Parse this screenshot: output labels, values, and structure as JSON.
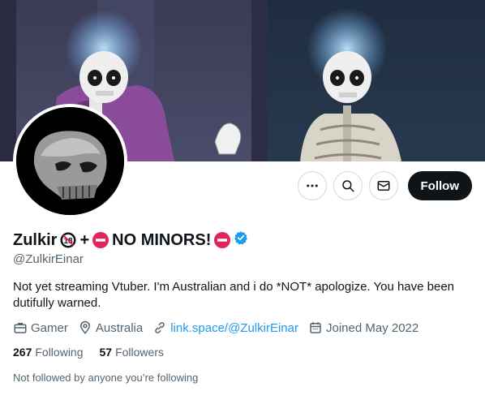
{
  "profile": {
    "name": "Zulkir",
    "name_suffix_plus": "+",
    "name_tag": "NO MINORS!",
    "handle": "@ZulkirEinar",
    "bio": "Not yet streaming Vtuber. I'm Australian and i do *NOT* apologize. You have been dutifully warned.",
    "verified": true
  },
  "meta": {
    "category": "Gamer",
    "location": "Australia",
    "link": "link.space/@ZulkirEinar",
    "joined": "Joined May 2022"
  },
  "stats": {
    "following_count": "267",
    "following_label": "Following",
    "followers_count": "57",
    "followers_label": "Followers"
  },
  "follow_note": "Not followed by anyone you’re following",
  "actions": {
    "follow_label": "Follow",
    "more_icon": "more-icon",
    "search_icon": "search-icon",
    "message_icon": "mail-icon"
  },
  "colors": {
    "verified_blue": "#1d9bf0",
    "link_blue": "#1d9bf0",
    "no_entry_red": "#e0245e"
  }
}
